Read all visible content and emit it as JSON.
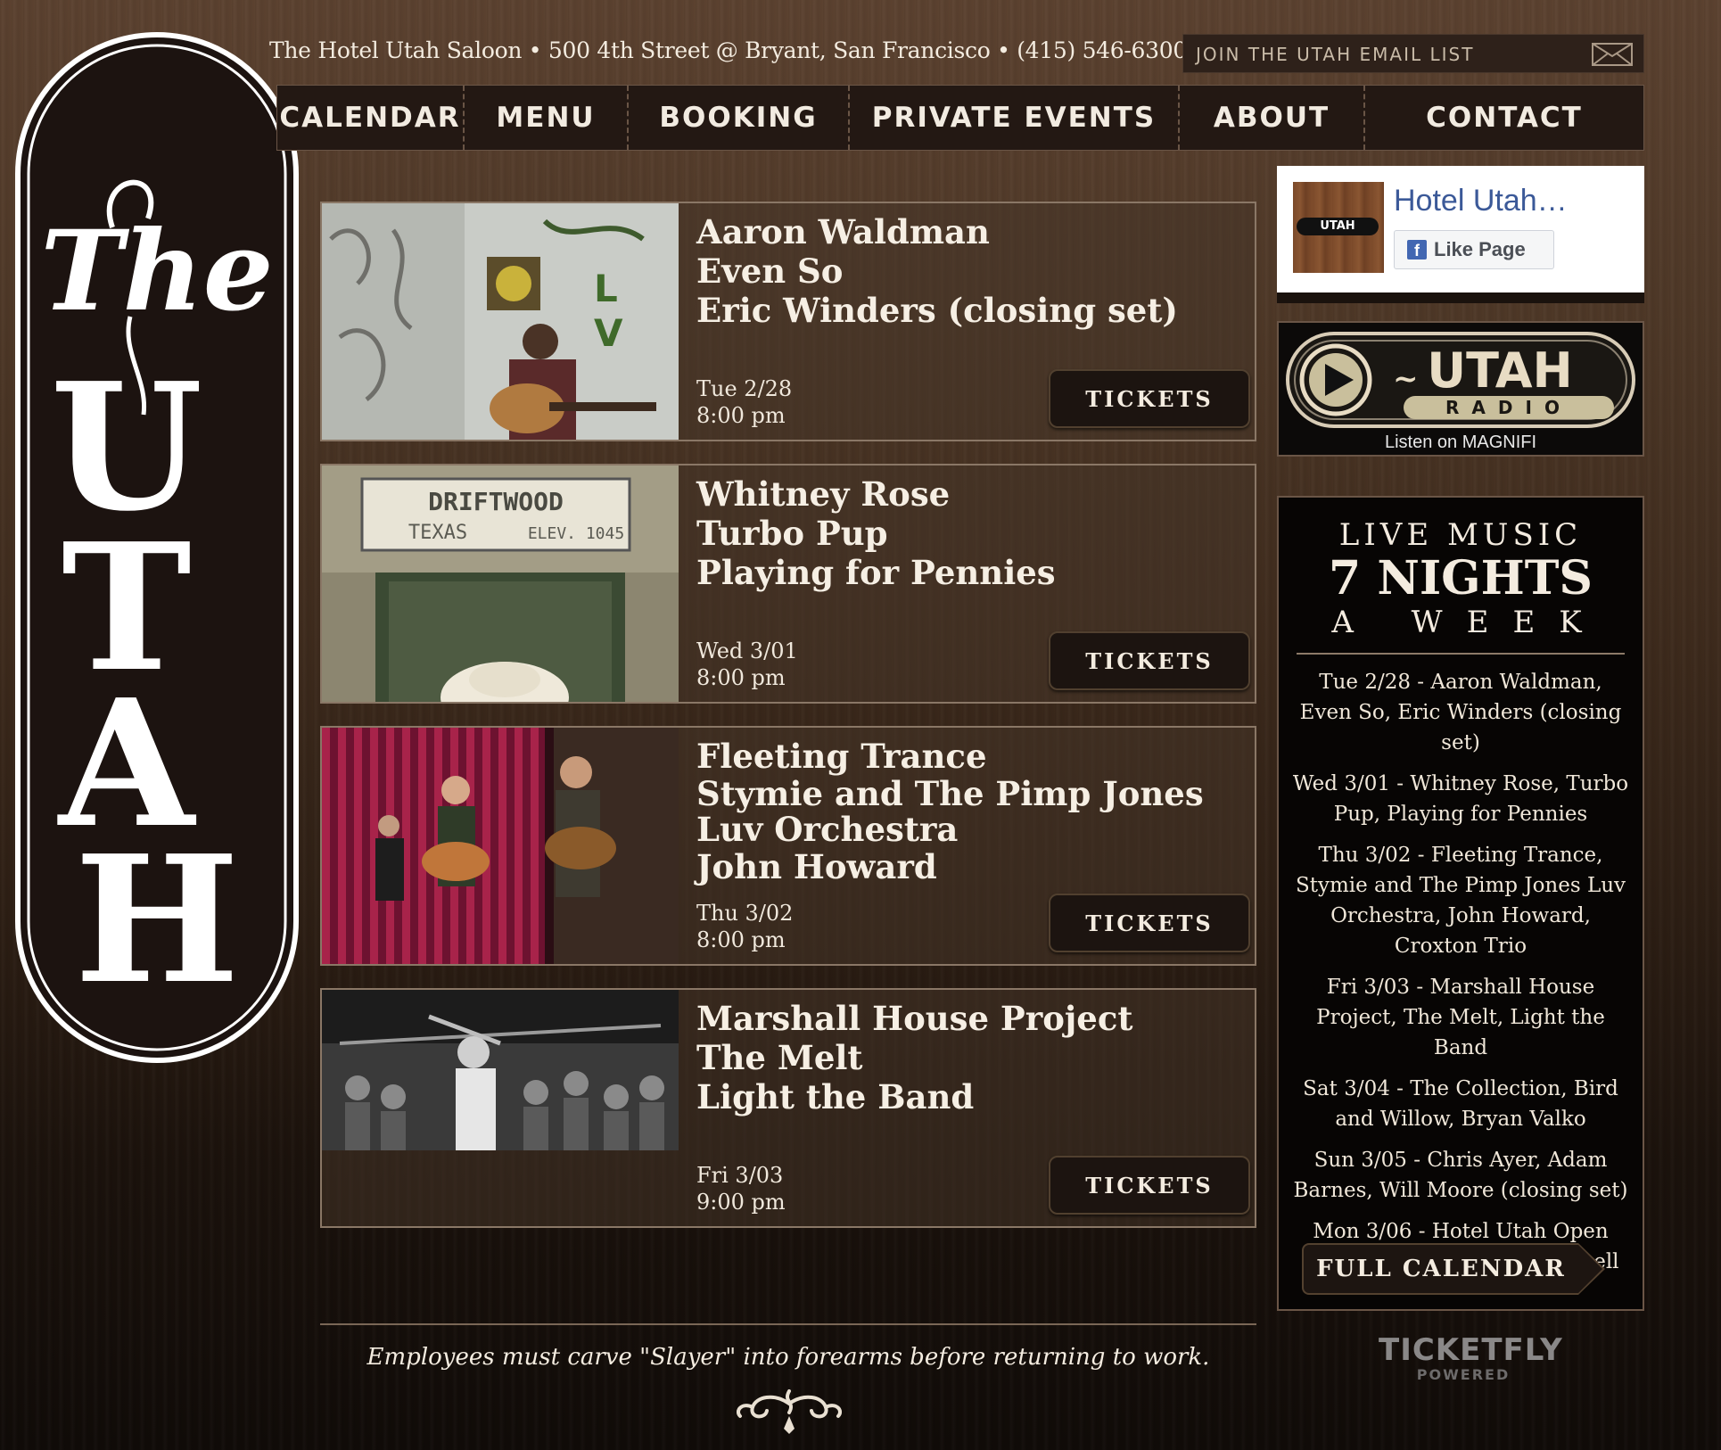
{
  "address": "The Hotel Utah Saloon • 500 4th Street @ Bryant, San Francisco • (415) 546-6300",
  "email_list": "JOIN THE UTAH EMAIL LIST",
  "nav": [
    "CALENDAR",
    "MENU",
    "BOOKING",
    "PRIVATE EVENTS",
    "ABOUT",
    "CONTACT"
  ],
  "events": [
    {
      "bands": [
        "Aaron Waldman",
        "Even So",
        "Eric Winders (closing set)"
      ],
      "date": "Tue 2/28",
      "time": "8:00 pm",
      "tickets": "TICKETS"
    },
    {
      "bands": [
        "Whitney Rose",
        "Turbo Pup",
        "Playing for Pennies"
      ],
      "date": "Wed 3/01",
      "time": "8:00 pm",
      "tickets": "TICKETS"
    },
    {
      "bands": [
        "Fleeting Trance",
        "Stymie and The Pimp Jones Luv Orchestra",
        "John Howard"
      ],
      "date": "Thu 3/02",
      "time": "8:00 pm",
      "tickets": "TICKETS"
    },
    {
      "bands": [
        "Marshall House Project",
        "The Melt",
        "Light the Band"
      ],
      "date": "Fri 3/03",
      "time": "9:00 pm",
      "tickets": "TICKETS"
    }
  ],
  "photo_text": {
    "driftwood_sign": "DRIFTWOOD",
    "driftwood_texas": "TEXAS",
    "driftwood_elev": "ELEV. 1045"
  },
  "facebook": {
    "page_name": "Hotel Utah…",
    "like_label": "Like Page",
    "thumb_text": "UTAH"
  },
  "radio": {
    "title": "UTAH",
    "subtitle": "RADIO",
    "listen": "Listen on MAGNIFI"
  },
  "live_music": {
    "line1": "LIVE MUSIC",
    "line2": "7 NIGHTS",
    "line3": "A WEEK",
    "listings": [
      "Tue 2/28 - Aaron Waldman, Even So, Eric Winders (closing set)",
      "Wed 3/01 - Whitney Rose, Turbo Pup, Playing for Pennies",
      "Thu 3/02 - Fleeting Trance, Stymie and The Pimp Jones Luv Orchestra, John Howard, Croxton Trio",
      "Fri 3/03 - Marshall House Project, The Melt, Light the Band",
      "Sat 3/04 - The Collection, Bird and Willow, Bryan Valko",
      "Sun 3/05 - Chris Ayer, Adam Barnes, Will Moore (closing set)",
      "Mon 3/06 - Hotel Utah Open Mic with host Brendan Getzell"
    ],
    "full_calendar": "FULL CALENDAR"
  },
  "footer": {
    "tagline": "Employees must carve \"Slayer\" into forearms before returning to work."
  },
  "ticketfly": {
    "name": "TICKETFLY",
    "powered": "POWERED"
  },
  "logo": {
    "the": "The",
    "utah": "UTAH"
  },
  "colors": {
    "background_top": "#5c4230",
    "background_bottom": "#100b08",
    "panel": "#231813",
    "border": "#6a5546",
    "text": "#f4ece0",
    "facebook_blue": "#3b5998"
  },
  "icons": [
    "envelope-icon",
    "play-icon",
    "facebook-icon",
    "flourish-icon"
  ]
}
